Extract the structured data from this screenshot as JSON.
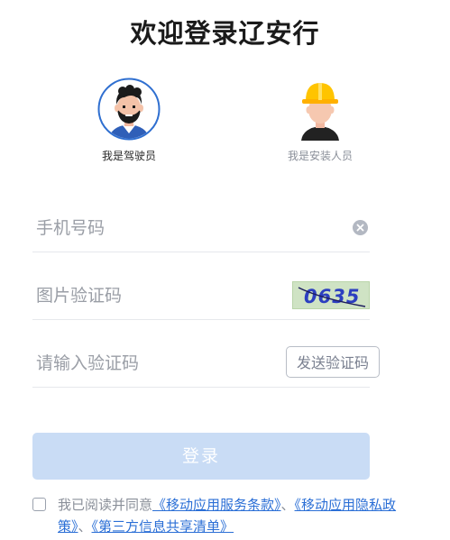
{
  "page": {
    "title": "欢迎登录辽安行"
  },
  "roles": [
    {
      "label": "我是驾驶员",
      "icon": "driver-avatar-icon",
      "selected": true
    },
    {
      "label": "我是安装人员",
      "icon": "installer-avatar-icon",
      "selected": false
    }
  ],
  "form": {
    "phone": {
      "value": "",
      "placeholder": "手机号码"
    },
    "captcha": {
      "value": "",
      "placeholder": "图片验证码",
      "image_text": "0635"
    },
    "sms_code": {
      "value": "",
      "placeholder": "请输入验证码",
      "send_label": "发送验证码"
    }
  },
  "login": {
    "label": "登录"
  },
  "agreement": {
    "prefix": "我已阅读并同意",
    "terms_link": "《移动应用服务条款》",
    "sep1": "、",
    "privacy_link": "《移动应用隐私政策》",
    "sep2": "、",
    "third_party_link": "《第三方信息共享清单》"
  },
  "colors": {
    "accent": "#2b6fd6",
    "login_disabled_bg": "#c9dcf5",
    "placeholder": "#9a9ea6"
  }
}
